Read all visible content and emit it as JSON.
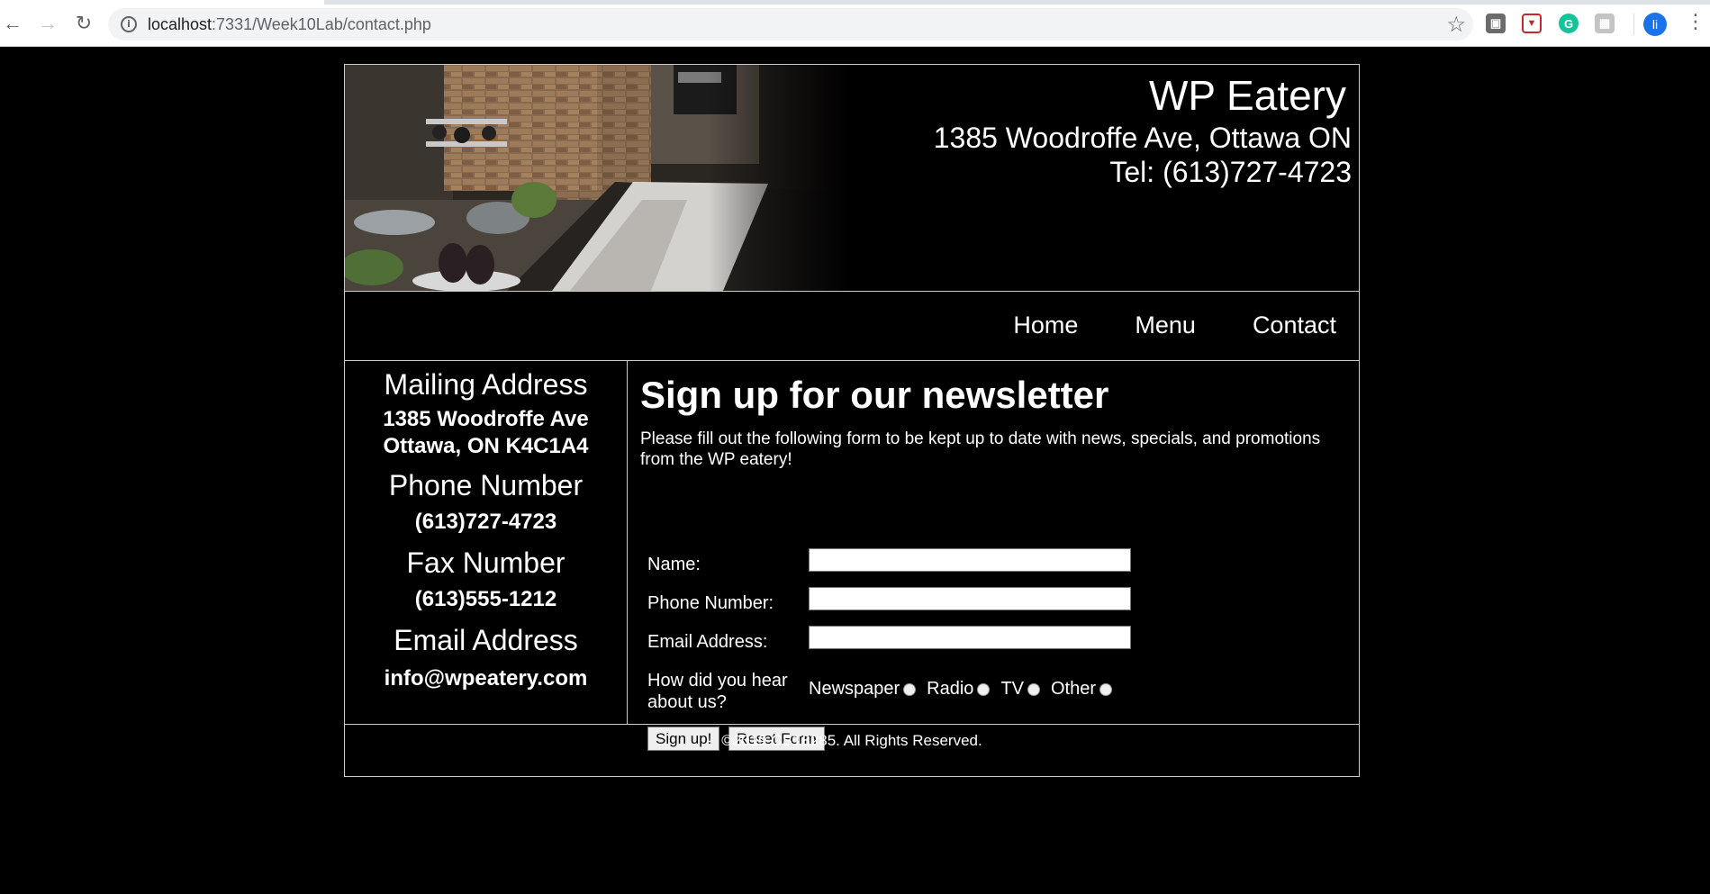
{
  "browser": {
    "url_host": "localhost",
    "url_path": ":7331/Week10Lab/contact.php",
    "profile_initial": "li"
  },
  "header": {
    "name": "WP Eatery",
    "address": "1385 Woodroffe Ave, Ottawa ON",
    "tel": "Tel: (613)727-4723"
  },
  "nav": {
    "items": [
      "Home",
      "Menu",
      "Contact"
    ]
  },
  "sidebar": {
    "mailing_heading": "Mailing Address",
    "mailing_line1": "1385 Woodroffe Ave",
    "mailing_line2": "Ottawa, ON K4C1A4",
    "phone_heading": "Phone Number",
    "phone_value": "(613)727-4723",
    "fax_heading": "Fax Number",
    "fax_value": "(613)555-1212",
    "email_heading": "Email Address",
    "email_value": "info@wpeatery.com"
  },
  "main": {
    "title": "Sign up for our newsletter",
    "intro": "Please fill out the following form to be kept up to date with news, specials, and promotions from the WP eatery!",
    "form": {
      "name_label": "Name:",
      "name_value": "",
      "phone_label": "Phone Number:",
      "phone_value": "",
      "email_label": "Email Address:",
      "email_value": "",
      "hear_label": "How did you hear about us?",
      "options": [
        "Newspaper",
        "Radio",
        "TV",
        "Other"
      ],
      "submit_label": "Sign up!",
      "reset_label": "Reset Form"
    }
  },
  "footer": {
    "copyright": "©2019 CST8285. All Rights Reserved."
  }
}
